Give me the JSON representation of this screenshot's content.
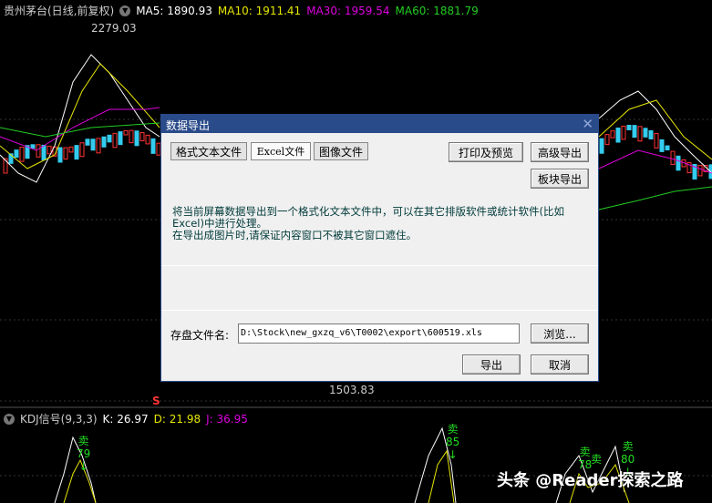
{
  "header": {
    "title": "贵州茅台(日线,前复权)",
    "ma5": "MA5: 1890.93",
    "ma10": "MA10: 1911.41",
    "ma30": "MA30: 1959.54",
    "ma60": "MA60: 1881.79"
  },
  "colors": {
    "ma5": "#ffffff",
    "ma10": "#e6e600",
    "ma30": "#dd00dd",
    "ma60": "#22cc22",
    "up": "#ff3333",
    "down": "#33ccee"
  },
  "price_labels": {
    "high": "2279.03",
    "low": "1503.83",
    "s_marker": "S"
  },
  "kdj": {
    "title": "KDJ信号(9,3,3)",
    "k": "K: 26.97",
    "d": "D: 21.98",
    "j": "J: 36.95"
  },
  "signals": [
    {
      "label": "卖",
      "value": "79"
    },
    {
      "label": "卖",
      "value": "85"
    },
    {
      "label": "卖",
      "value": "78"
    },
    {
      "label": "卖",
      "value": ""
    },
    {
      "label": "卖",
      "value": "80"
    }
  ],
  "dialog": {
    "title": "数据导出",
    "tabs": [
      "格式文本文件",
      "Excel文件",
      "图像文件"
    ],
    "print_preview": "打印及预览",
    "advanced_export": "高级导出",
    "block_export": "板块导出",
    "description_line1": "将当前屏幕数据导出到一个格式化文本文件中，可以在其它排版软件或统计软件(比如Excel)中进行处理。",
    "description_line2": "在导出成图片时,请保证内容窗口不被其它窗口遮住。",
    "filename_label": "存盘文件名:",
    "filename_value": "D:\\Stock\\new_gxzq_v6\\T0002\\export\\600519.xls",
    "browse": "浏览...",
    "export": "导出",
    "cancel": "取消"
  },
  "watermark": "头条 @Reader探索之路"
}
